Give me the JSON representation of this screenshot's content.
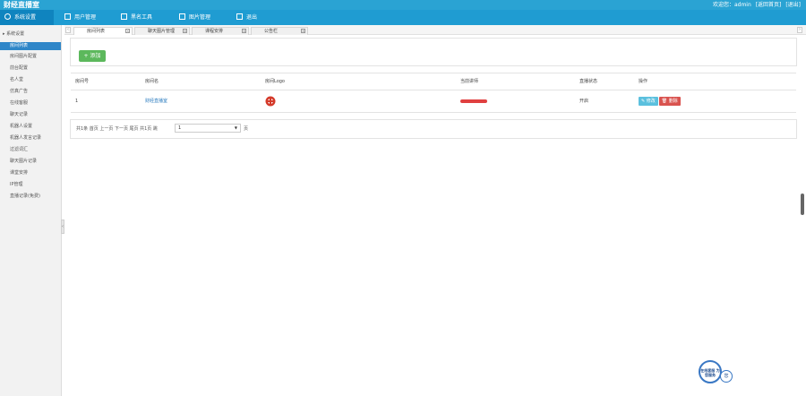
{
  "app": {
    "title": "财经直播室"
  },
  "user_area": {
    "greeting": "欢迎您：admin",
    "home_link": "[返回首页]",
    "logout_link": "[退出]"
  },
  "nav": [
    {
      "label": "系统设置",
      "active": true
    },
    {
      "label": "用户管理",
      "active": false
    },
    {
      "label": "黑名工具",
      "active": false
    },
    {
      "label": "图片管理",
      "active": false
    },
    {
      "label": "退出",
      "active": false
    }
  ],
  "sidebar": {
    "group_label": "系统设置",
    "items": [
      "房间列表",
      "房间图片配置",
      "前台配置",
      "名人堂",
      "仿真广告",
      "在线客服",
      "聊天记录",
      "机器人设置",
      "机器人发言记录",
      "过滤词汇",
      "聊天图片记录",
      "课堂安排",
      "IP管理",
      "直播记录(免费)"
    ],
    "active_index": 0,
    "collapse_glyph": "‹"
  },
  "tabs": [
    {
      "label": "房间列表",
      "active": true
    },
    {
      "label": "聊天图片管理",
      "active": false
    },
    {
      "label": "课程安排",
      "active": false
    },
    {
      "label": "公告栏",
      "active": false
    }
  ],
  "toolbar": {
    "add_label": "+ 添加"
  },
  "table": {
    "headers": [
      "房间号",
      "房间名",
      "房间Logo",
      "当前讲师",
      "直播状态",
      "操作"
    ],
    "rows": [
      {
        "id": "1",
        "name": "财经直播室",
        "teacher": "",
        "status": "开启",
        "edit_label": "✎ 修改",
        "delete_label": "🗑 删除"
      }
    ]
  },
  "pager": {
    "text": "共1条 首页 上一页 下一页 尾页 共1页  跳",
    "selected_page": "1",
    "suffix": "页"
  },
  "service": {
    "badge_text": "在线客服 为您服务",
    "bubble_text": "您"
  },
  "colors": {
    "header": "#2aa3d3",
    "nav": "#1f9cd2",
    "active": "#2f86c8",
    "add": "#5cb85c",
    "edit": "#5bc0de",
    "delete": "#d9534f"
  }
}
